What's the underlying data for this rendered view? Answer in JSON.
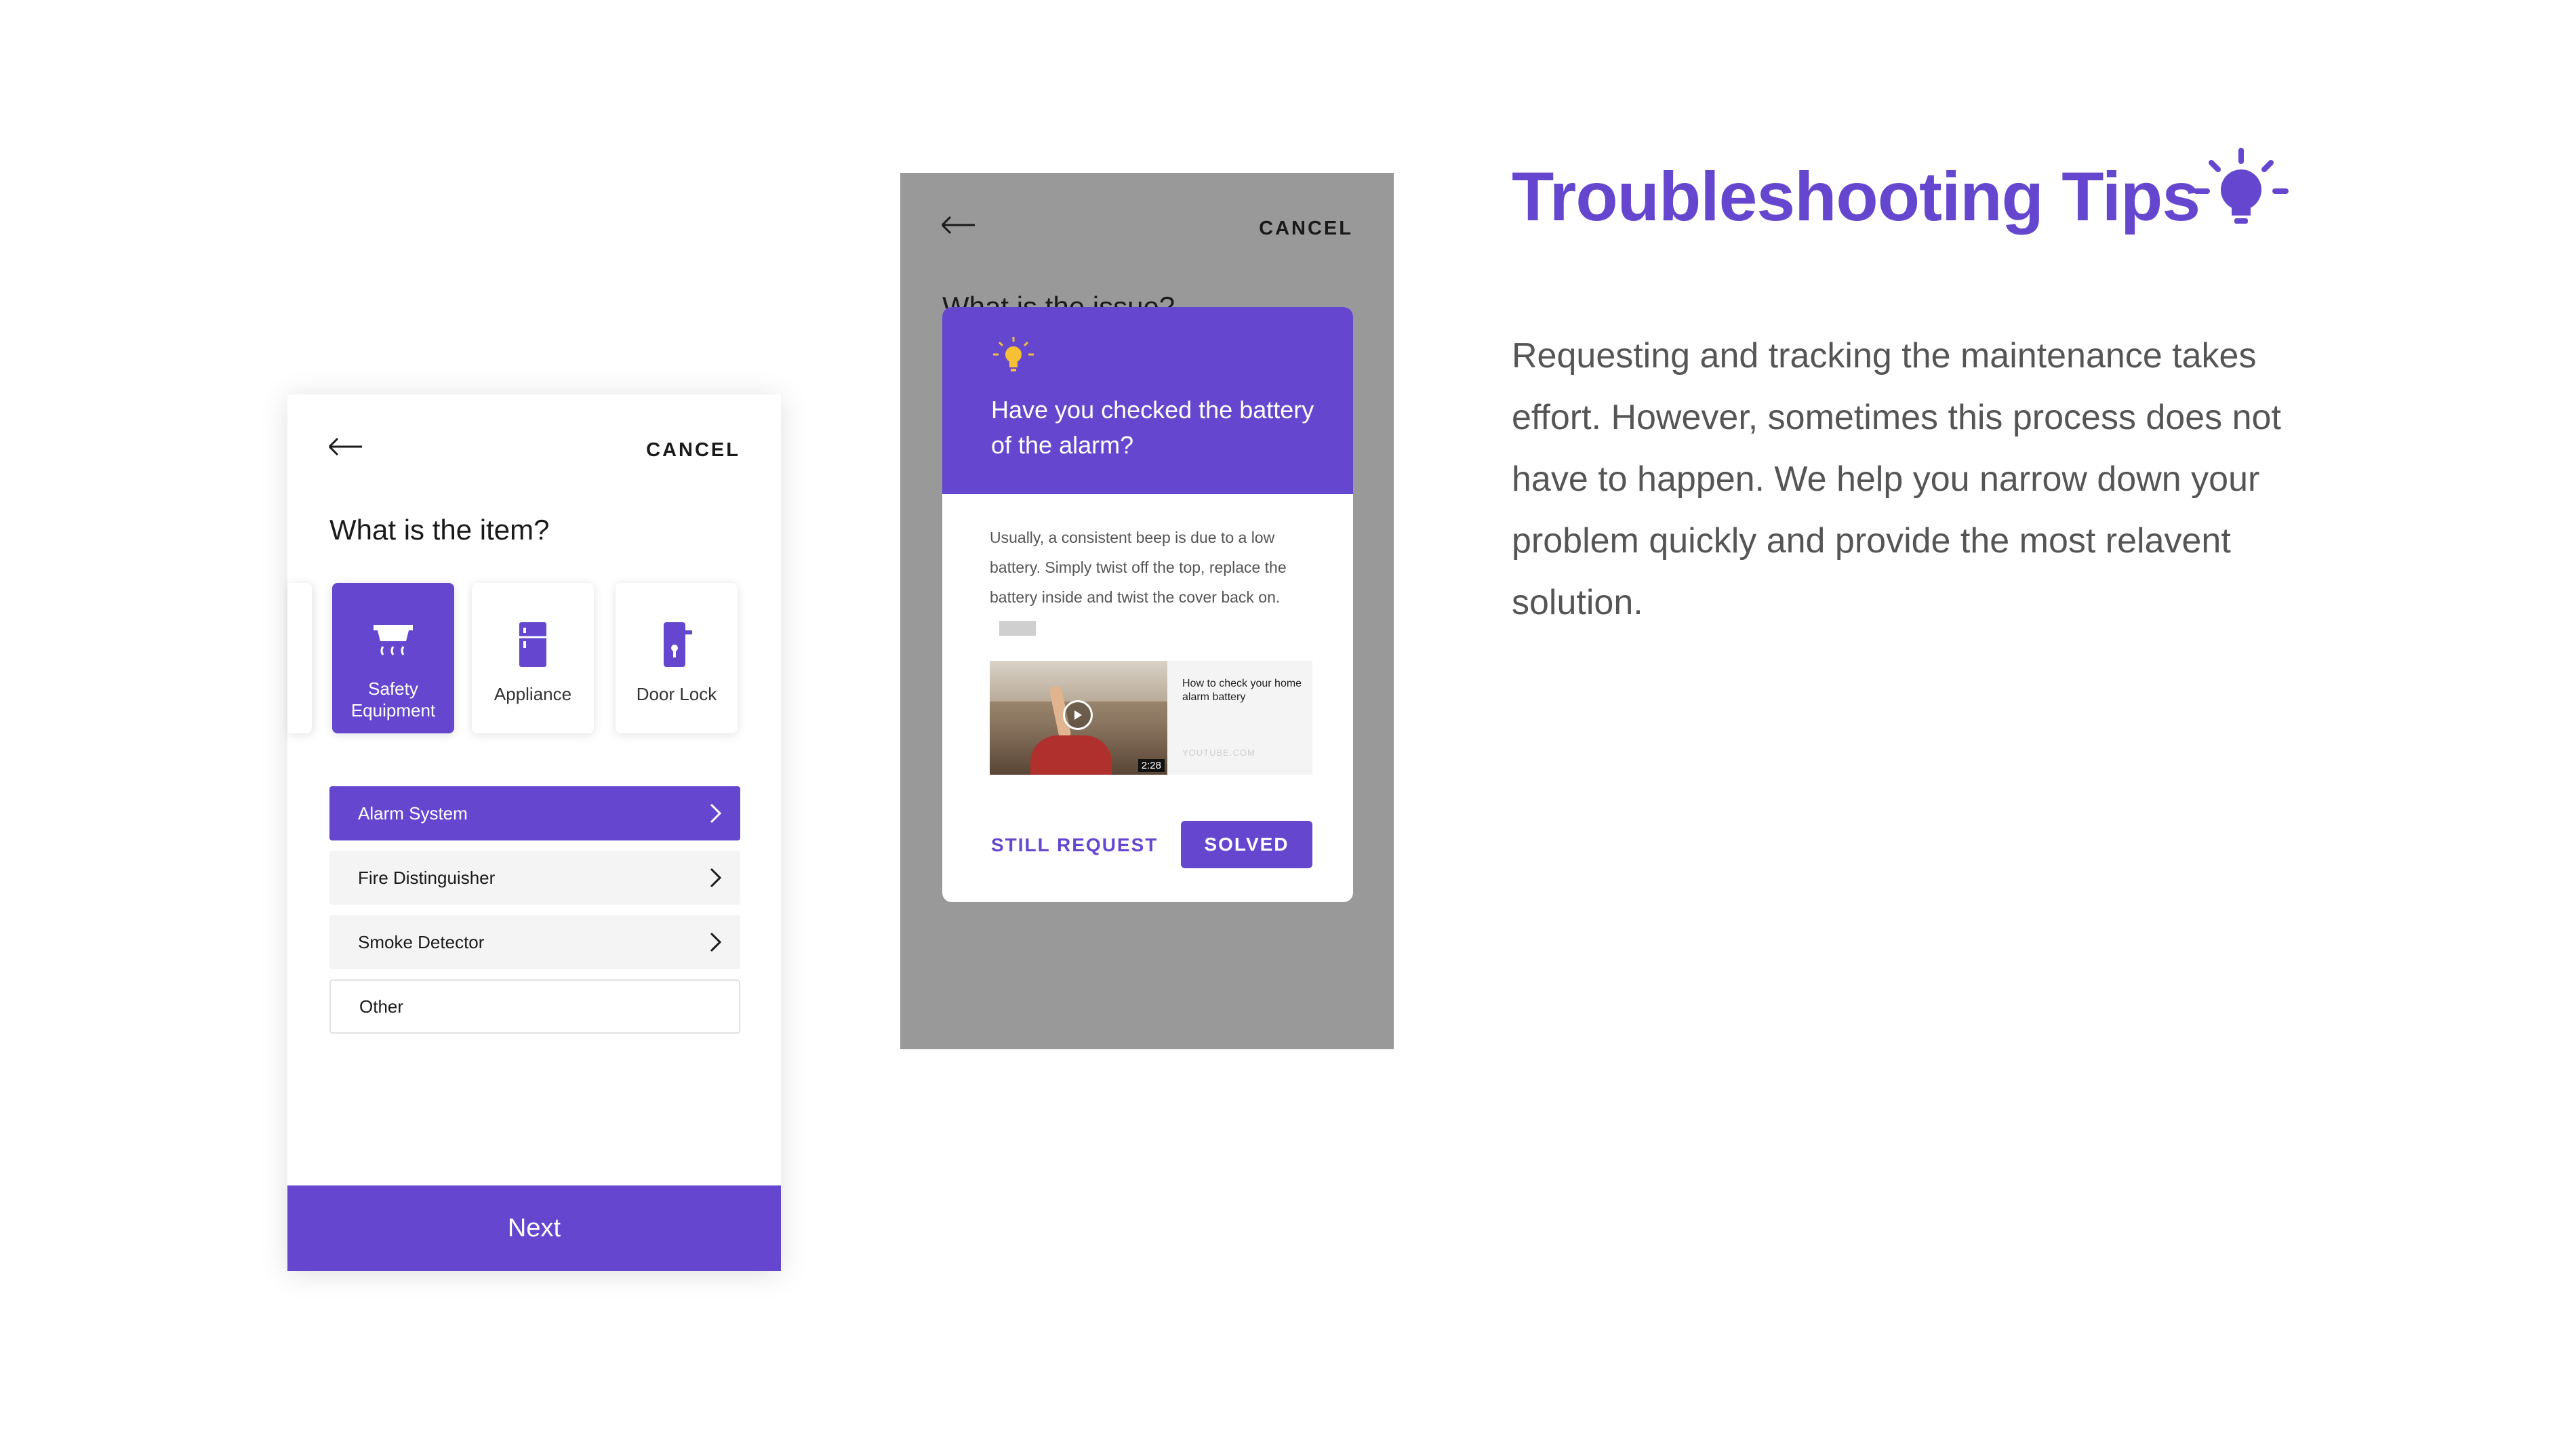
{
  "colors": {
    "accent": "#6547cf",
    "overlay": "#999999",
    "bulb": "#f5c034"
  },
  "screen1": {
    "cancel": "CANCEL",
    "title": "What is the item?",
    "categories": [
      {
        "label": "Safety Equipment",
        "icon": "smoke-detector-icon",
        "selected": true
      },
      {
        "label": "Appliance",
        "icon": "fridge-icon",
        "selected": false
      },
      {
        "label": "Door Lock",
        "icon": "door-lock-icon",
        "selected": false
      }
    ],
    "options": [
      "Alarm System",
      "Fire Distinguisher",
      "Smoke Detector",
      "Other"
    ],
    "next": "Next"
  },
  "screen2": {
    "cancel": "CANCEL",
    "title": "What is the issue?",
    "modal": {
      "question": "Have you checked the battery of the alarm?",
      "body": "Usually, a consistent beep is due to a low battery. Simply twist off the top, replace the battery inside and twist the cover back on.",
      "video": {
        "title": "How to check your home alarm battery",
        "duration": "2:28",
        "source": "YOUTUBE.COM"
      },
      "still_request": "STILL REQUEST",
      "solved": "SOLVED"
    }
  },
  "tips": {
    "heading": "Troubleshooting Tips",
    "description": "Requesting and tracking the maintenance takes effort. However, sometimes this process does not have to happen. We help you narrow down your problem quickly and provide the most relavent solution."
  }
}
